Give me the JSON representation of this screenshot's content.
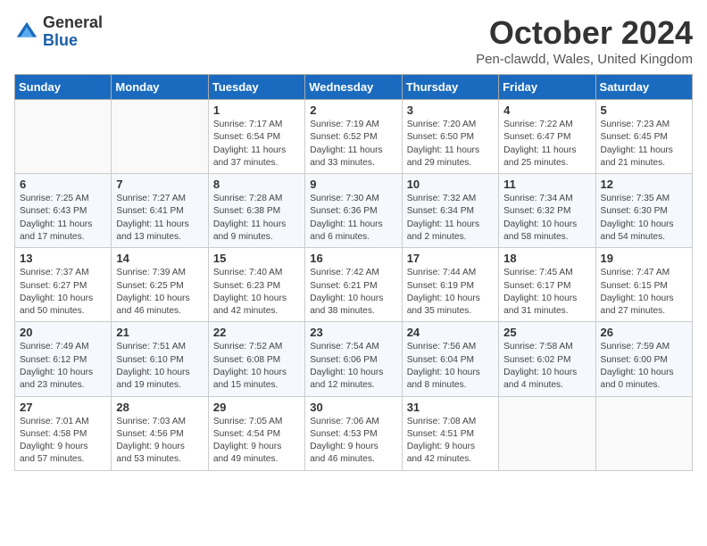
{
  "header": {
    "logo_line1": "General",
    "logo_line2": "Blue",
    "month": "October 2024",
    "location": "Pen-clawdd, Wales, United Kingdom"
  },
  "weekdays": [
    "Sunday",
    "Monday",
    "Tuesday",
    "Wednesday",
    "Thursday",
    "Friday",
    "Saturday"
  ],
  "weeks": [
    [
      {
        "day": "",
        "info": ""
      },
      {
        "day": "",
        "info": ""
      },
      {
        "day": "1",
        "info": "Sunrise: 7:17 AM\nSunset: 6:54 PM\nDaylight: 11 hours\nand 37 minutes."
      },
      {
        "day": "2",
        "info": "Sunrise: 7:19 AM\nSunset: 6:52 PM\nDaylight: 11 hours\nand 33 minutes."
      },
      {
        "day": "3",
        "info": "Sunrise: 7:20 AM\nSunset: 6:50 PM\nDaylight: 11 hours\nand 29 minutes."
      },
      {
        "day": "4",
        "info": "Sunrise: 7:22 AM\nSunset: 6:47 PM\nDaylight: 11 hours\nand 25 minutes."
      },
      {
        "day": "5",
        "info": "Sunrise: 7:23 AM\nSunset: 6:45 PM\nDaylight: 11 hours\nand 21 minutes."
      }
    ],
    [
      {
        "day": "6",
        "info": "Sunrise: 7:25 AM\nSunset: 6:43 PM\nDaylight: 11 hours\nand 17 minutes."
      },
      {
        "day": "7",
        "info": "Sunrise: 7:27 AM\nSunset: 6:41 PM\nDaylight: 11 hours\nand 13 minutes."
      },
      {
        "day": "8",
        "info": "Sunrise: 7:28 AM\nSunset: 6:38 PM\nDaylight: 11 hours\nand 9 minutes."
      },
      {
        "day": "9",
        "info": "Sunrise: 7:30 AM\nSunset: 6:36 PM\nDaylight: 11 hours\nand 6 minutes."
      },
      {
        "day": "10",
        "info": "Sunrise: 7:32 AM\nSunset: 6:34 PM\nDaylight: 11 hours\nand 2 minutes."
      },
      {
        "day": "11",
        "info": "Sunrise: 7:34 AM\nSunset: 6:32 PM\nDaylight: 10 hours\nand 58 minutes."
      },
      {
        "day": "12",
        "info": "Sunrise: 7:35 AM\nSunset: 6:30 PM\nDaylight: 10 hours\nand 54 minutes."
      }
    ],
    [
      {
        "day": "13",
        "info": "Sunrise: 7:37 AM\nSunset: 6:27 PM\nDaylight: 10 hours\nand 50 minutes."
      },
      {
        "day": "14",
        "info": "Sunrise: 7:39 AM\nSunset: 6:25 PM\nDaylight: 10 hours\nand 46 minutes."
      },
      {
        "day": "15",
        "info": "Sunrise: 7:40 AM\nSunset: 6:23 PM\nDaylight: 10 hours\nand 42 minutes."
      },
      {
        "day": "16",
        "info": "Sunrise: 7:42 AM\nSunset: 6:21 PM\nDaylight: 10 hours\nand 38 minutes."
      },
      {
        "day": "17",
        "info": "Sunrise: 7:44 AM\nSunset: 6:19 PM\nDaylight: 10 hours\nand 35 minutes."
      },
      {
        "day": "18",
        "info": "Sunrise: 7:45 AM\nSunset: 6:17 PM\nDaylight: 10 hours\nand 31 minutes."
      },
      {
        "day": "19",
        "info": "Sunrise: 7:47 AM\nSunset: 6:15 PM\nDaylight: 10 hours\nand 27 minutes."
      }
    ],
    [
      {
        "day": "20",
        "info": "Sunrise: 7:49 AM\nSunset: 6:12 PM\nDaylight: 10 hours\nand 23 minutes."
      },
      {
        "day": "21",
        "info": "Sunrise: 7:51 AM\nSunset: 6:10 PM\nDaylight: 10 hours\nand 19 minutes."
      },
      {
        "day": "22",
        "info": "Sunrise: 7:52 AM\nSunset: 6:08 PM\nDaylight: 10 hours\nand 15 minutes."
      },
      {
        "day": "23",
        "info": "Sunrise: 7:54 AM\nSunset: 6:06 PM\nDaylight: 10 hours\nand 12 minutes."
      },
      {
        "day": "24",
        "info": "Sunrise: 7:56 AM\nSunset: 6:04 PM\nDaylight: 10 hours\nand 8 minutes."
      },
      {
        "day": "25",
        "info": "Sunrise: 7:58 AM\nSunset: 6:02 PM\nDaylight: 10 hours\nand 4 minutes."
      },
      {
        "day": "26",
        "info": "Sunrise: 7:59 AM\nSunset: 6:00 PM\nDaylight: 10 hours\nand 0 minutes."
      }
    ],
    [
      {
        "day": "27",
        "info": "Sunrise: 7:01 AM\nSunset: 4:58 PM\nDaylight: 9 hours\nand 57 minutes."
      },
      {
        "day": "28",
        "info": "Sunrise: 7:03 AM\nSunset: 4:56 PM\nDaylight: 9 hours\nand 53 minutes."
      },
      {
        "day": "29",
        "info": "Sunrise: 7:05 AM\nSunset: 4:54 PM\nDaylight: 9 hours\nand 49 minutes."
      },
      {
        "day": "30",
        "info": "Sunrise: 7:06 AM\nSunset: 4:53 PM\nDaylight: 9 hours\nand 46 minutes."
      },
      {
        "day": "31",
        "info": "Sunrise: 7:08 AM\nSunset: 4:51 PM\nDaylight: 9 hours\nand 42 minutes."
      },
      {
        "day": "",
        "info": ""
      },
      {
        "day": "",
        "info": ""
      }
    ]
  ]
}
